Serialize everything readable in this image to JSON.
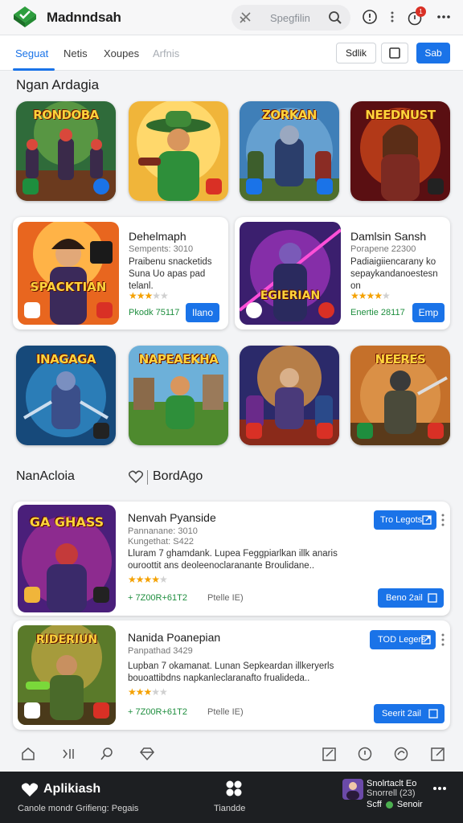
{
  "header": {
    "app_title": "Madnndsah",
    "search_placeholder": "Spegfilin",
    "notification_count": "1"
  },
  "tabs": [
    {
      "label": "Seguat",
      "active": true
    },
    {
      "label": "Netis",
      "active": false
    },
    {
      "label": "Xoupes",
      "active": false
    },
    {
      "label": "Arfnis",
      "active": false
    }
  ],
  "toolbar": {
    "filter_label": "Sdlik",
    "save_label": "Sab"
  },
  "section1": {
    "title": "Ngan Ardagia",
    "tiles_row1": [
      {
        "title": "RONDOBA"
      },
      {
        "title": ""
      },
      {
        "title": "ZORKAN"
      },
      {
        "title": "NEEDNUST"
      }
    ],
    "feature_cards": [
      {
        "thumb_title": "SPACKTIAN",
        "name": "Dehelmaph",
        "meta": "Sempents: 3010",
        "desc": "Praibenu snacketids Suna  Uo apas pad telanl.",
        "rating": 3,
        "price": "Pkodk 75117",
        "action": "Ilano"
      },
      {
        "thumb_title": "EGIERIAN",
        "name": "Damlsin Sansh",
        "meta": "Porapene 22300",
        "desc": "Padiaigiiencarany ko sepaykandanoestesn on",
        "rating": 4,
        "price": "Enertie 28117",
        "action": "Emp"
      }
    ],
    "tiles_row2": [
      {
        "title": "INAGAGA"
      },
      {
        "title": "NAPEAEKHA"
      },
      {
        "title": ""
      },
      {
        "title": "NEERES"
      }
    ]
  },
  "section2": {
    "title": "NanAcloia",
    "link_label": "BordAgo",
    "list": [
      {
        "thumb_title": "GA GHASS",
        "name": "Nenvah Pyanside",
        "meta1": "Pannanane: 3010",
        "meta2": "Kungethat: S422",
        "desc": "Lluram 7 ghamdank. Lupea Feggpiarlkan illk anaris ouroottit ans deoleenoclaranante Broulidane..",
        "rating": 4,
        "price": "+ 7Z00R+61T2",
        "size": "Ptelle IE)",
        "top_action": "Tro Legots",
        "action": "Beno 2ail"
      },
      {
        "thumb_title": "RIDERIUN",
        "name": "Nanida Poanepian",
        "meta1": "Panpathad 3429",
        "meta2": "",
        "desc": "Lupban 7 okamanat. Lunan Sepkeardan illkeryerls bouoattibdns napkanleclaranafto frualideda..",
        "rating": 3,
        "price": "+ 7Z00R+61T2",
        "size": "Ptelle IE)",
        "top_action": "TOD Legers",
        "action": "Seerit 2ail"
      }
    ]
  },
  "bottom_bar": {
    "title": "Aplikiash",
    "subtitle": "Canole mondr Grifieng: Pegais",
    "center_label": "Tiandde",
    "user_name": "Snolrtaclt Eo",
    "user_line2": "Snorrell (23)",
    "user_line3": "Scff",
    "user_line4": "Senoir"
  },
  "colors": {
    "accent": "#1a73e8",
    "star": "#f4a100",
    "price_green": "#1e8e3e",
    "bottom_bar": "#1d1f22"
  }
}
